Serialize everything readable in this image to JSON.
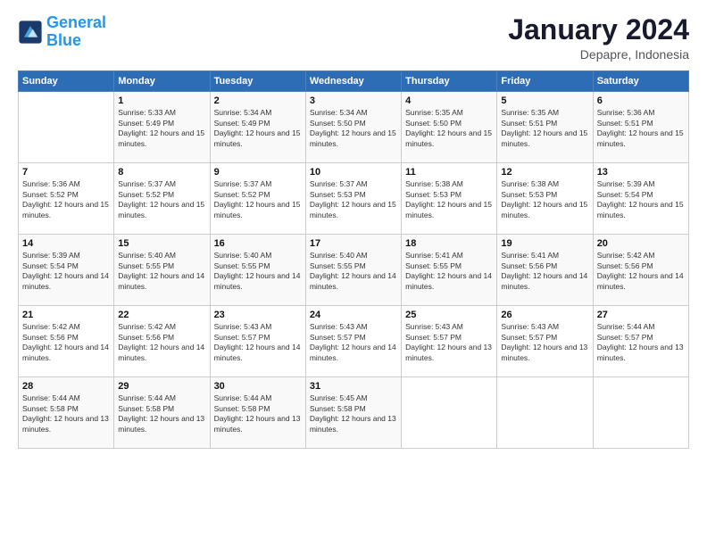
{
  "logo": {
    "line1": "General",
    "line2": "Blue"
  },
  "title": "January 2024",
  "location": "Depapre, Indonesia",
  "days_header": [
    "Sunday",
    "Monday",
    "Tuesday",
    "Wednesday",
    "Thursday",
    "Friday",
    "Saturday"
  ],
  "weeks": [
    [
      {
        "day": "",
        "sunrise": "",
        "sunset": "",
        "daylight": ""
      },
      {
        "day": "1",
        "sunrise": "Sunrise: 5:33 AM",
        "sunset": "Sunset: 5:49 PM",
        "daylight": "Daylight: 12 hours and 15 minutes."
      },
      {
        "day": "2",
        "sunrise": "Sunrise: 5:34 AM",
        "sunset": "Sunset: 5:49 PM",
        "daylight": "Daylight: 12 hours and 15 minutes."
      },
      {
        "day": "3",
        "sunrise": "Sunrise: 5:34 AM",
        "sunset": "Sunset: 5:50 PM",
        "daylight": "Daylight: 12 hours and 15 minutes."
      },
      {
        "day": "4",
        "sunrise": "Sunrise: 5:35 AM",
        "sunset": "Sunset: 5:50 PM",
        "daylight": "Daylight: 12 hours and 15 minutes."
      },
      {
        "day": "5",
        "sunrise": "Sunrise: 5:35 AM",
        "sunset": "Sunset: 5:51 PM",
        "daylight": "Daylight: 12 hours and 15 minutes."
      },
      {
        "day": "6",
        "sunrise": "Sunrise: 5:36 AM",
        "sunset": "Sunset: 5:51 PM",
        "daylight": "Daylight: 12 hours and 15 minutes."
      }
    ],
    [
      {
        "day": "7",
        "sunrise": "Sunrise: 5:36 AM",
        "sunset": "Sunset: 5:52 PM",
        "daylight": "Daylight: 12 hours and 15 minutes."
      },
      {
        "day": "8",
        "sunrise": "Sunrise: 5:37 AM",
        "sunset": "Sunset: 5:52 PM",
        "daylight": "Daylight: 12 hours and 15 minutes."
      },
      {
        "day": "9",
        "sunrise": "Sunrise: 5:37 AM",
        "sunset": "Sunset: 5:52 PM",
        "daylight": "Daylight: 12 hours and 15 minutes."
      },
      {
        "day": "10",
        "sunrise": "Sunrise: 5:37 AM",
        "sunset": "Sunset: 5:53 PM",
        "daylight": "Daylight: 12 hours and 15 minutes."
      },
      {
        "day": "11",
        "sunrise": "Sunrise: 5:38 AM",
        "sunset": "Sunset: 5:53 PM",
        "daylight": "Daylight: 12 hours and 15 minutes."
      },
      {
        "day": "12",
        "sunrise": "Sunrise: 5:38 AM",
        "sunset": "Sunset: 5:53 PM",
        "daylight": "Daylight: 12 hours and 15 minutes."
      },
      {
        "day": "13",
        "sunrise": "Sunrise: 5:39 AM",
        "sunset": "Sunset: 5:54 PM",
        "daylight": "Daylight: 12 hours and 15 minutes."
      }
    ],
    [
      {
        "day": "14",
        "sunrise": "Sunrise: 5:39 AM",
        "sunset": "Sunset: 5:54 PM",
        "daylight": "Daylight: 12 hours and 14 minutes."
      },
      {
        "day": "15",
        "sunrise": "Sunrise: 5:40 AM",
        "sunset": "Sunset: 5:55 PM",
        "daylight": "Daylight: 12 hours and 14 minutes."
      },
      {
        "day": "16",
        "sunrise": "Sunrise: 5:40 AM",
        "sunset": "Sunset: 5:55 PM",
        "daylight": "Daylight: 12 hours and 14 minutes."
      },
      {
        "day": "17",
        "sunrise": "Sunrise: 5:40 AM",
        "sunset": "Sunset: 5:55 PM",
        "daylight": "Daylight: 12 hours and 14 minutes."
      },
      {
        "day": "18",
        "sunrise": "Sunrise: 5:41 AM",
        "sunset": "Sunset: 5:55 PM",
        "daylight": "Daylight: 12 hours and 14 minutes."
      },
      {
        "day": "19",
        "sunrise": "Sunrise: 5:41 AM",
        "sunset": "Sunset: 5:56 PM",
        "daylight": "Daylight: 12 hours and 14 minutes."
      },
      {
        "day": "20",
        "sunrise": "Sunrise: 5:42 AM",
        "sunset": "Sunset: 5:56 PM",
        "daylight": "Daylight: 12 hours and 14 minutes."
      }
    ],
    [
      {
        "day": "21",
        "sunrise": "Sunrise: 5:42 AM",
        "sunset": "Sunset: 5:56 PM",
        "daylight": "Daylight: 12 hours and 14 minutes."
      },
      {
        "day": "22",
        "sunrise": "Sunrise: 5:42 AM",
        "sunset": "Sunset: 5:56 PM",
        "daylight": "Daylight: 12 hours and 14 minutes."
      },
      {
        "day": "23",
        "sunrise": "Sunrise: 5:43 AM",
        "sunset": "Sunset: 5:57 PM",
        "daylight": "Daylight: 12 hours and 14 minutes."
      },
      {
        "day": "24",
        "sunrise": "Sunrise: 5:43 AM",
        "sunset": "Sunset: 5:57 PM",
        "daylight": "Daylight: 12 hours and 14 minutes."
      },
      {
        "day": "25",
        "sunrise": "Sunrise: 5:43 AM",
        "sunset": "Sunset: 5:57 PM",
        "daylight": "Daylight: 12 hours and 13 minutes."
      },
      {
        "day": "26",
        "sunrise": "Sunrise: 5:43 AM",
        "sunset": "Sunset: 5:57 PM",
        "daylight": "Daylight: 12 hours and 13 minutes."
      },
      {
        "day": "27",
        "sunrise": "Sunrise: 5:44 AM",
        "sunset": "Sunset: 5:57 PM",
        "daylight": "Daylight: 12 hours and 13 minutes."
      }
    ],
    [
      {
        "day": "28",
        "sunrise": "Sunrise: 5:44 AM",
        "sunset": "Sunset: 5:58 PM",
        "daylight": "Daylight: 12 hours and 13 minutes."
      },
      {
        "day": "29",
        "sunrise": "Sunrise: 5:44 AM",
        "sunset": "Sunset: 5:58 PM",
        "daylight": "Daylight: 12 hours and 13 minutes."
      },
      {
        "day": "30",
        "sunrise": "Sunrise: 5:44 AM",
        "sunset": "Sunset: 5:58 PM",
        "daylight": "Daylight: 12 hours and 13 minutes."
      },
      {
        "day": "31",
        "sunrise": "Sunrise: 5:45 AM",
        "sunset": "Sunset: 5:58 PM",
        "daylight": "Daylight: 12 hours and 13 minutes."
      },
      {
        "day": "",
        "sunrise": "",
        "sunset": "",
        "daylight": ""
      },
      {
        "day": "",
        "sunrise": "",
        "sunset": "",
        "daylight": ""
      },
      {
        "day": "",
        "sunrise": "",
        "sunset": "",
        "daylight": ""
      }
    ]
  ]
}
